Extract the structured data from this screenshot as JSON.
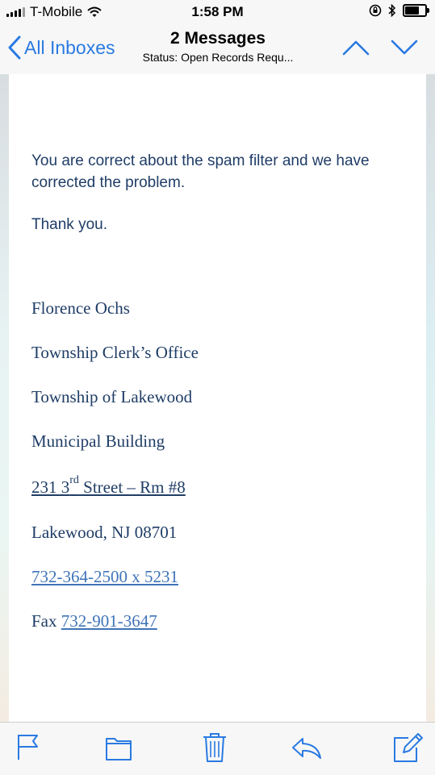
{
  "status_bar": {
    "carrier": "T-Mobile",
    "time": "1:58 PM"
  },
  "nav": {
    "back_label": "All Inboxes",
    "title": "2 Messages",
    "subtitle": "Status: Open Records Requ..."
  },
  "email": {
    "paragraph1": "You are correct about the spam filter and we have corrected the problem.",
    "paragraph2": "Thank you.",
    "signature": {
      "name": "Florence Ochs",
      "office": "Township Clerk’s Office",
      "township": "Township of Lakewood",
      "building": "Municipal Building",
      "address_number": "231 3",
      "address_sup": "rd",
      "address_street": " Street – Rm #8",
      "city": "Lakewood, NJ  08701",
      "phone": "732-364-2500 x 5231",
      "fax_label": "Fax ",
      "fax_number": "732-901-3647"
    }
  },
  "icons": {
    "accent_color": "#2a7ae2",
    "toolbar": [
      "flag-icon",
      "folder-icon",
      "trash-icon",
      "reply-icon",
      "compose-icon"
    ]
  }
}
